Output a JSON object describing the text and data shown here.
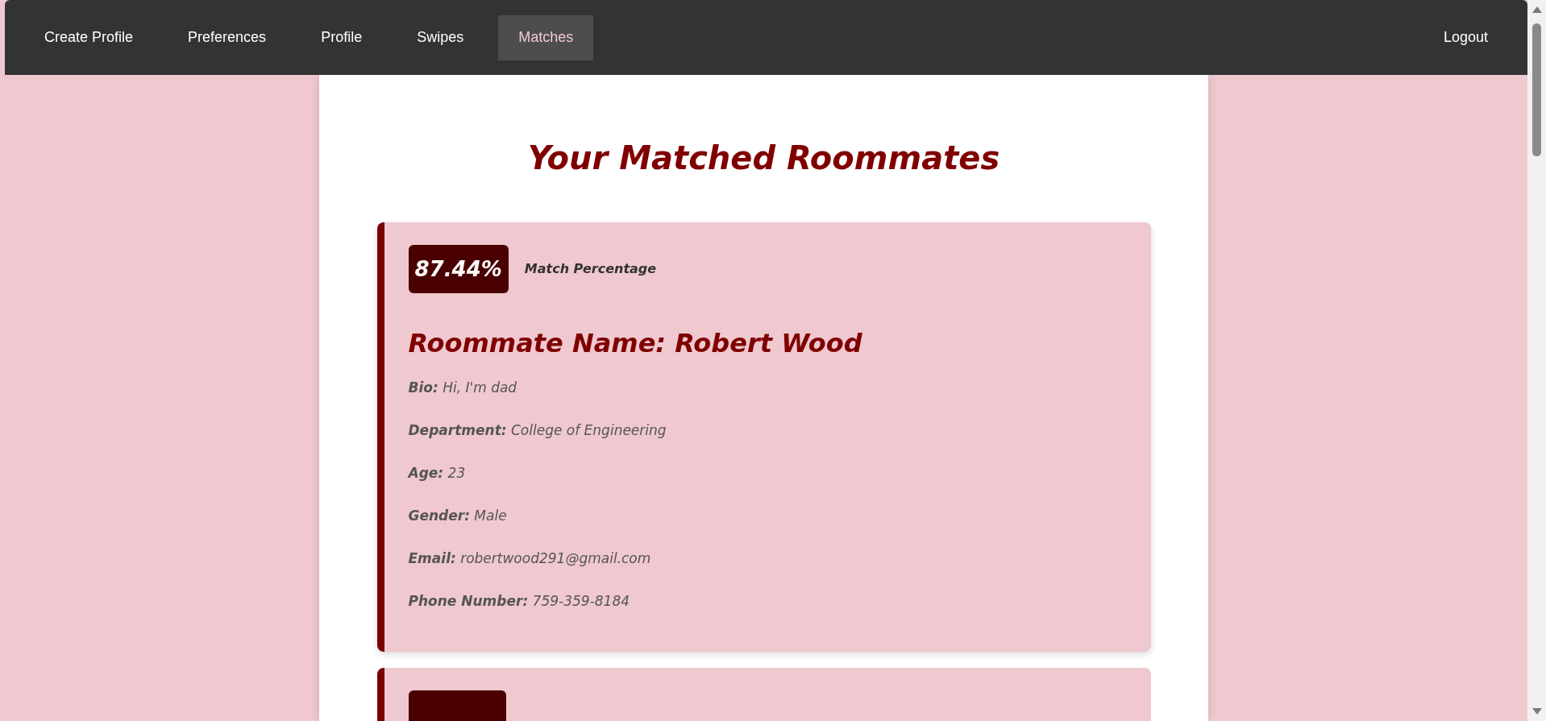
{
  "nav": {
    "items": [
      {
        "label": "Create Profile",
        "selected": false
      },
      {
        "label": "Preferences",
        "selected": false
      },
      {
        "label": "Profile",
        "selected": false
      },
      {
        "label": "Swipes",
        "selected": false
      },
      {
        "label": "Matches",
        "selected": true
      }
    ],
    "logout": "Logout"
  },
  "title": "Your Matched Roommates",
  "matches": [
    {
      "percentage": "87.44%",
      "percentage_label": "Match Percentage",
      "name": "Roommate Name: Robert Wood",
      "fields": [
        "**Bio:** Hi, I'm dad",
        "**Department:** College of Engineering",
        "**Age:** 23",
        "**Gender:** Male",
        "**Email:** robertwood291@gmail.com",
        "**Phone Number:** 759-359-8184"
      ]
    }
  ]
}
